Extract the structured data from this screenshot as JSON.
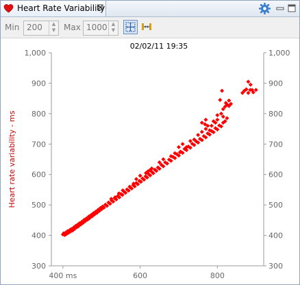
{
  "tab": {
    "title": "Heart Rate Variability",
    "close_glyph": "⊠",
    "icon": "heart-icon"
  },
  "window_controls": {
    "settings_icon": "gear-icon",
    "minimize_icon": "minimize-icon",
    "maximize_icon": "maximize-icon"
  },
  "toolbar": {
    "min_label": "Min",
    "min_value": "200",
    "max_label": "Max",
    "max_value": "1000",
    "fit_icon": "fit-to-screen-icon",
    "range_icon": "range-icon"
  },
  "chart_data": {
    "type": "scatter",
    "title": "02/02/11 19:35",
    "xlabel": "",
    "ylabel": "Heart rate variability  - ms",
    "xlim": [
      370,
      920
    ],
    "ylim": [
      300,
      1000
    ],
    "x_ticks": [
      "400 ms",
      "600",
      "800"
    ],
    "y_ticks_left": [
      "300",
      "400",
      "500",
      "600",
      "700",
      "800",
      "900",
      "1,000"
    ],
    "y_ticks_right": [
      "300",
      "400",
      "500",
      "600",
      "700",
      "800",
      "900",
      "1,000"
    ],
    "grid": false,
    "colors": {
      "points": "#ff0000",
      "ylabel": "#cc0000",
      "axis": "#9a9a9a"
    },
    "series": [
      {
        "name": "",
        "points": [
          [
            400,
            403
          ],
          [
            402,
            407
          ],
          [
            405,
            401
          ],
          [
            408,
            410
          ],
          [
            410,
            405
          ],
          [
            412,
            414
          ],
          [
            415,
            409
          ],
          [
            418,
            418
          ],
          [
            420,
            413
          ],
          [
            422,
            421
          ],
          [
            425,
            416
          ],
          [
            428,
            426
          ],
          [
            430,
            421
          ],
          [
            433,
            431
          ],
          [
            436,
            427
          ],
          [
            438,
            435
          ],
          [
            440,
            432
          ],
          [
            443,
            440
          ],
          [
            446,
            436
          ],
          [
            449,
            445
          ],
          [
            452,
            441
          ],
          [
            455,
            451
          ],
          [
            458,
            447
          ],
          [
            461,
            456
          ],
          [
            464,
            452
          ],
          [
            467,
            462
          ],
          [
            470,
            458
          ],
          [
            473,
            467
          ],
          [
            476,
            463
          ],
          [
            479,
            473
          ],
          [
            482,
            469
          ],
          [
            485,
            478
          ],
          [
            488,
            474
          ],
          [
            491,
            484
          ],
          [
            494,
            480
          ],
          [
            497,
            490
          ],
          [
            500,
            486
          ],
          [
            503,
            495
          ],
          [
            506,
            491
          ],
          [
            510,
            501
          ],
          [
            514,
            497
          ],
          [
            518,
            508
          ],
          [
            522,
            504
          ],
          [
            526,
            515
          ],
          [
            530,
            511
          ],
          [
            534,
            522
          ],
          [
            538,
            518
          ],
          [
            542,
            529
          ],
          [
            546,
            525
          ],
          [
            550,
            536
          ],
          [
            554,
            533
          ],
          [
            558,
            544
          ],
          [
            562,
            540
          ],
          [
            566,
            551
          ],
          [
            570,
            547
          ],
          [
            574,
            558
          ],
          [
            578,
            554
          ],
          [
            582,
            565
          ],
          [
            586,
            561
          ],
          [
            590,
            572
          ],
          [
            594,
            568
          ],
          [
            598,
            579
          ],
          [
            602,
            576
          ],
          [
            606,
            587
          ],
          [
            610,
            583
          ],
          [
            614,
            594
          ],
          [
            618,
            590
          ],
          [
            622,
            601
          ],
          [
            626,
            597
          ],
          [
            630,
            609
          ],
          [
            634,
            604
          ],
          [
            638,
            616
          ],
          [
            642,
            612
          ],
          [
            646,
            623
          ],
          [
            650,
            619
          ],
          [
            655,
            632
          ],
          [
            660,
            627
          ],
          [
            665,
            640
          ],
          [
            670,
            636
          ],
          [
            675,
            649
          ],
          [
            680,
            645
          ],
          [
            685,
            658
          ],
          [
            690,
            654
          ],
          [
            695,
            667
          ],
          [
            700,
            662
          ],
          [
            705,
            675
          ],
          [
            710,
            671
          ],
          [
            715,
            684
          ],
          [
            720,
            680
          ],
          [
            725,
            692
          ],
          [
            730,
            688
          ],
          [
            735,
            701
          ],
          [
            740,
            697
          ],
          [
            745,
            709
          ],
          [
            750,
            705
          ],
          [
            755,
            717
          ],
          [
            760,
            713
          ],
          [
            765,
            726
          ],
          [
            770,
            722
          ],
          [
            775,
            735
          ],
          [
            780,
            731
          ],
          [
            785,
            743
          ],
          [
            790,
            739
          ],
          [
            795,
            752
          ],
          [
            800,
            748
          ],
          [
            805,
            761
          ],
          [
            810,
            758
          ],
          [
            815,
            770
          ],
          [
            820,
            775
          ],
          [
            825,
            785
          ],
          [
            810,
            800
          ],
          [
            815,
            815
          ],
          [
            820,
            823
          ],
          [
            825,
            830
          ],
          [
            830,
            825
          ],
          [
            835,
            832
          ],
          [
            830,
            843
          ],
          [
            822,
            835
          ],
          [
            760,
            770
          ],
          [
            770,
            780
          ],
          [
            740,
            715
          ],
          [
            750,
            730
          ],
          [
            680,
            660
          ],
          [
            690,
            670
          ],
          [
            590,
            585
          ],
          [
            600,
            596
          ],
          [
            545,
            538
          ],
          [
            555,
            548
          ],
          [
            468,
            456
          ],
          [
            476,
            466
          ],
          [
            700,
            690
          ],
          [
            710,
            700
          ],
          [
            650,
            640
          ],
          [
            660,
            650
          ],
          [
            620,
            610
          ],
          [
            630,
            620
          ],
          [
            525,
            520
          ],
          [
            535,
            525
          ],
          [
            440,
            430
          ],
          [
            448,
            438
          ],
          [
            790,
            775
          ],
          [
            800,
            780
          ],
          [
            785,
            760
          ],
          [
            795,
            770
          ],
          [
            703,
            673
          ],
          [
            770,
            750
          ],
          [
            780,
            745
          ],
          [
            760,
            740
          ],
          [
            720,
            690
          ],
          [
            730,
            710
          ],
          [
            807,
            845
          ],
          [
            812,
            875
          ],
          [
            865,
            868
          ],
          [
            870,
            875
          ],
          [
            875,
            880
          ],
          [
            880,
            868
          ],
          [
            885,
            878
          ],
          [
            890,
            878
          ],
          [
            893,
            870
          ],
          [
            900,
            878
          ],
          [
            880,
            905
          ],
          [
            886,
            895
          ],
          [
            800,
            795
          ],
          [
            815,
            790
          ],
          [
            768,
            765
          ],
          [
            775,
            760
          ],
          [
            615,
            605
          ],
          [
            625,
            614
          ],
          [
            573,
            560
          ],
          [
            583,
            570
          ]
        ]
      }
    ]
  }
}
